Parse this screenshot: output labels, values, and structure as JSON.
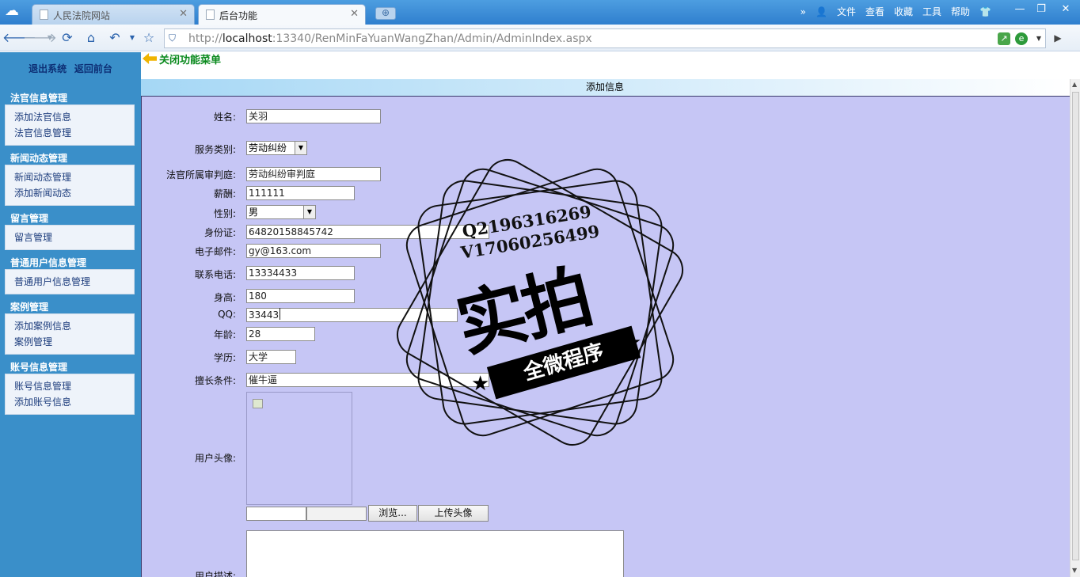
{
  "browser": {
    "tabs": [
      {
        "label": "人民法院网站",
        "active": false
      },
      {
        "label": "后台功能",
        "active": true
      }
    ],
    "menu": [
      "文件",
      "查看",
      "收藏",
      "工具",
      "帮助"
    ],
    "more": "»",
    "url_prefix": "http://",
    "url_host": "localhost",
    "url_rest": ":13340/RenMinFaYuanWangZhan/Admin/AdminIndex.aspx"
  },
  "sidebar": {
    "top_links": [
      "退出系统",
      "返回前台"
    ],
    "groups": [
      {
        "title": "法官信息管理",
        "items": [
          "添加法官信息",
          "法官信息管理"
        ]
      },
      {
        "title": "新闻动态管理",
        "items": [
          "新闻动态管理",
          "添加新闻动态"
        ]
      },
      {
        "title": "留言管理",
        "items": [
          "留言管理"
        ]
      },
      {
        "title": "普通用户信息管理",
        "items": [
          "普通用户信息管理"
        ]
      },
      {
        "title": "案例管理",
        "items": [
          "添加案例信息",
          "案例管理"
        ]
      },
      {
        "title": "账号信息管理",
        "items": [
          "账号信息管理",
          "添加账号信息"
        ]
      }
    ]
  },
  "main": {
    "close_menu": "关闭功能菜单",
    "section_title": "添加信息",
    "form": {
      "name": {
        "label": "姓名:",
        "value": "关羽"
      },
      "service_type": {
        "label": "服务类别:",
        "value": "劳动纠纷"
      },
      "court": {
        "label": "法官所属审判庭:",
        "value": "劳动纠纷审判庭"
      },
      "salary": {
        "label": "薪酬:",
        "value": "111111"
      },
      "gender": {
        "label": "性别:",
        "value": "男"
      },
      "id_card": {
        "label": "身份证:",
        "value": "64820158845742"
      },
      "email": {
        "label": "电子邮件:",
        "value": "gy@163.com"
      },
      "phone": {
        "label": "联系电话:",
        "value": "13334433"
      },
      "height": {
        "label": "身高:",
        "value": "180"
      },
      "qq": {
        "label": "QQ:",
        "value": "33443"
      },
      "age": {
        "label": "年龄:",
        "value": "28"
      },
      "education": {
        "label": "学历:",
        "value": "大学"
      },
      "specialty": {
        "label": "擅长条件:",
        "value": "催牛逼"
      },
      "avatar": {
        "label": "用户头像:"
      },
      "browse_button": "浏览...",
      "upload_button": "上传头像",
      "description": {
        "label": "用户描述:"
      }
    }
  },
  "watermark": {
    "line1": "Q2196316269",
    "line2": "V17060256499",
    "big": "实拍",
    "ribbon": "全微程序"
  }
}
